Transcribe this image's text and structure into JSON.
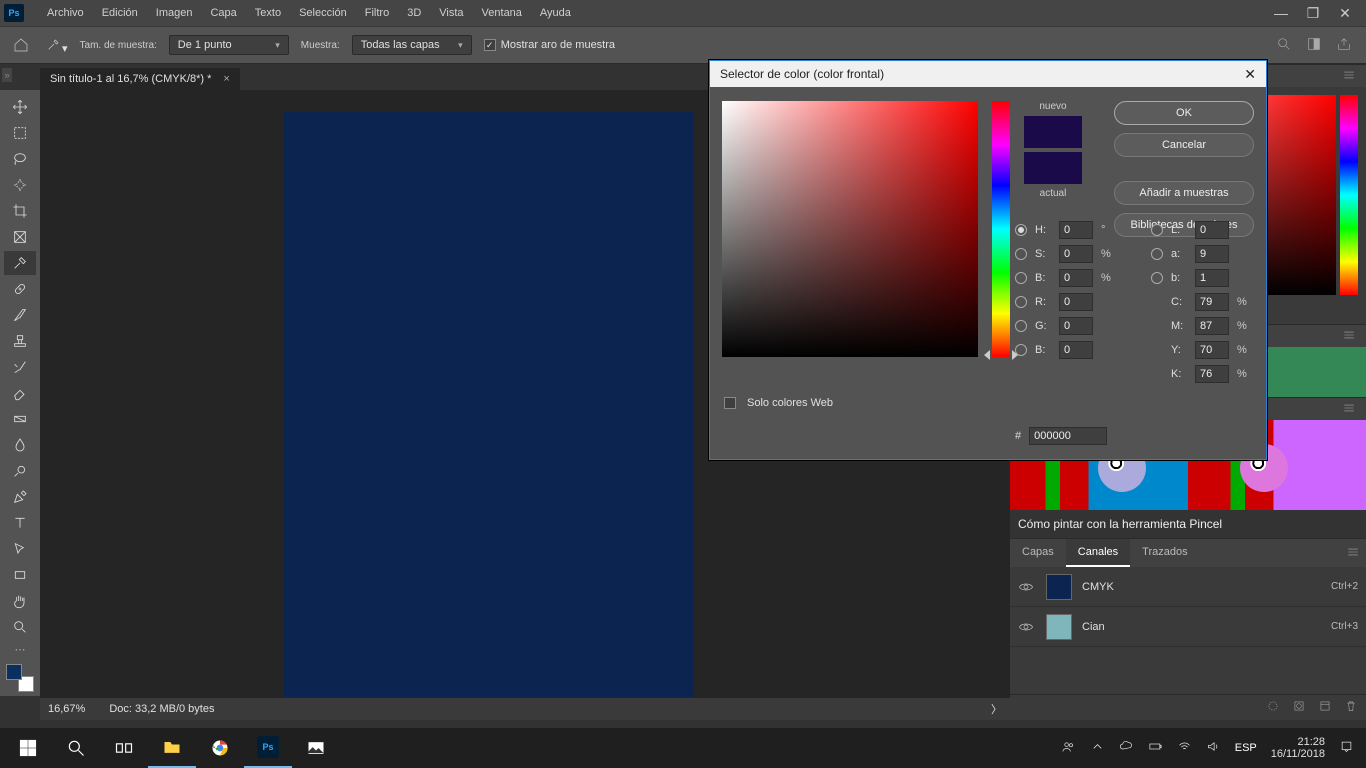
{
  "menu": {
    "items": [
      "Archivo",
      "Edición",
      "Imagen",
      "Capa",
      "Texto",
      "Selección",
      "Filtro",
      "3D",
      "Vista",
      "Ventana",
      "Ayuda"
    ]
  },
  "optionsBar": {
    "sampleSizeLabel": "Tam. de muestra:",
    "sampleSizeValue": "De 1 punto",
    "sampleLabel": "Muestra:",
    "sampleValue": "Todas las capas",
    "showRing": "Mostrar aro de muestra"
  },
  "document": {
    "tab": "Sin título-1 al 16,7% (CMYK/8*) *"
  },
  "status": {
    "zoom": "16,67%",
    "doc": "Doc: 33,2 MB/0 bytes"
  },
  "learn": {
    "title": "Cómo pintar con la herramienta Pincel"
  },
  "layersTabs": {
    "capas": "Capas",
    "canales": "Canales",
    "trazados": "Trazados"
  },
  "channels": [
    {
      "name": "CMYK",
      "shortcut": "Ctrl+2",
      "color": "#0b2550"
    },
    {
      "name": "Cian",
      "shortcut": "Ctrl+3",
      "color": "#7fb6bb"
    }
  ],
  "picker": {
    "title": "Selector de color (color frontal)",
    "ok": "OK",
    "cancel": "Cancelar",
    "add": "Añadir a muestras",
    "libs": "Bibliotecas de colores",
    "nuevo": "nuevo",
    "actual": "actual",
    "webOnly": "Solo colores Web",
    "H": {
      "l": "H:",
      "v": "0",
      "u": "°"
    },
    "S": {
      "l": "S:",
      "v": "0",
      "u": "%"
    },
    "Bb": {
      "l": "B:",
      "v": "0",
      "u": "%"
    },
    "L": {
      "l": "L:",
      "v": "0"
    },
    "a": {
      "l": "a:",
      "v": "9"
    },
    "b": {
      "l": "b:",
      "v": "1"
    },
    "R": {
      "l": "R:",
      "v": "0"
    },
    "G": {
      "l": "G:",
      "v": "0"
    },
    "B2": {
      "l": "B:",
      "v": "0"
    },
    "C": {
      "l": "C:",
      "v": "79",
      "u": "%"
    },
    "M": {
      "l": "M:",
      "v": "87",
      "u": "%"
    },
    "Y": {
      "l": "Y:",
      "v": "70",
      "u": "%"
    },
    "K": {
      "l": "K:",
      "v": "76",
      "u": "%"
    },
    "hashLabel": "#",
    "hex": "000000"
  },
  "taskbar": {
    "lang": "ESP",
    "time": "21:28",
    "date": "16/11/2018"
  }
}
